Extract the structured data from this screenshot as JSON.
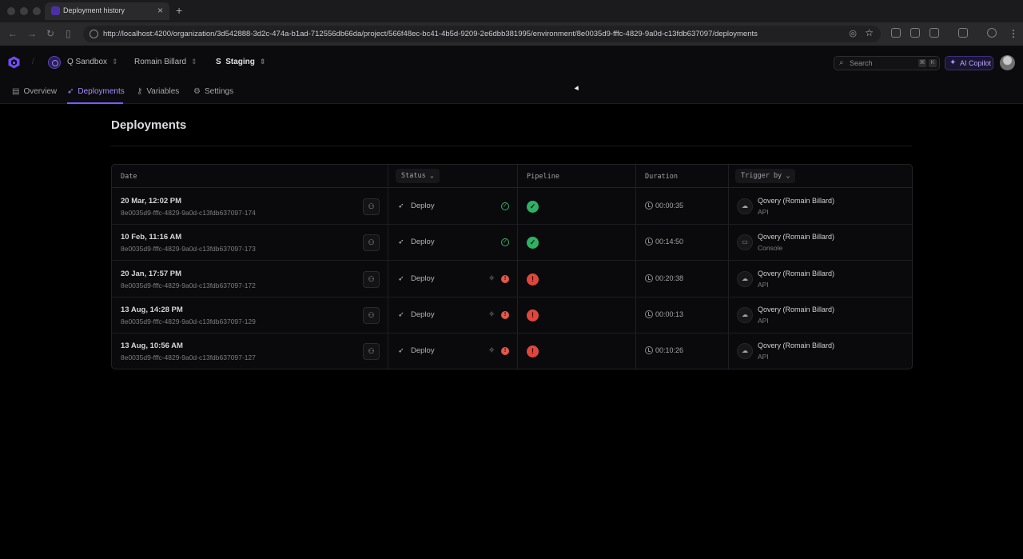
{
  "browser": {
    "tab_title": "Deployment history",
    "tab_close": "×",
    "new_tab": "+",
    "url": "http://localhost:4200/organization/3d542888-3d2c-474a-b1ad-712556db66da/project/566f48ec-bc41-4b5d-9209-2e6dbb381995/environment/8e0035d9-fffc-4829-9a0d-c13fdb637097/deployments"
  },
  "header": {
    "org": "Q Sandbox",
    "project": "Romain Billard",
    "env_badge": "S",
    "environment": "Staging",
    "search_placeholder": "Search",
    "search_keys": [
      "⌘",
      "K"
    ],
    "copilot_label": "AI Copilot"
  },
  "subnav": {
    "items": [
      {
        "label": "Overview",
        "icon": "overview-icon"
      },
      {
        "label": "Deployments",
        "icon": "rocket-icon",
        "active": true
      },
      {
        "label": "Variables",
        "icon": "key-icon"
      },
      {
        "label": "Settings",
        "icon": "gear-icon"
      }
    ]
  },
  "page": {
    "title": "Deployments"
  },
  "table": {
    "columns": {
      "date": "Date",
      "status": "Status",
      "pipeline": "Pipeline",
      "duration": "Duration",
      "trigger": "Trigger by"
    },
    "rows": [
      {
        "date": "20 Mar, 12:02 PM",
        "id": "8e0035d9-fffc-4829-9a0d-c13fdb637097-174",
        "status": "Deploy",
        "result": "success",
        "duration": "00:00:35",
        "trigger": "Qovery (Romain Billard)",
        "source": "API"
      },
      {
        "date": "10 Feb, 11:16 AM",
        "id": "8e0035d9-fffc-4829-9a0d-c13fdb637097-173",
        "status": "Deploy",
        "result": "success",
        "duration": "00:14:50",
        "trigger": "Qovery (Romain Billard)",
        "source": "Console"
      },
      {
        "date": "20 Jan, 17:57 PM",
        "id": "8e0035d9-fffc-4829-9a0d-c13fdb637097-172",
        "status": "Deploy",
        "result": "error",
        "duration": "00:20:38",
        "trigger": "Qovery (Romain Billard)",
        "source": "API"
      },
      {
        "date": "13 Aug, 14:28 PM",
        "id": "8e0035d9-fffc-4829-9a0d-c13fdb637097-129",
        "status": "Deploy",
        "result": "error",
        "duration": "00:00:13",
        "trigger": "Qovery (Romain Billard)",
        "source": "API"
      },
      {
        "date": "13 Aug, 10:56 AM",
        "id": "8e0035d9-fffc-4829-9a0d-c13fdb637097-127",
        "status": "Deploy",
        "result": "error",
        "duration": "00:10:26",
        "trigger": "Qovery (Romain Billard)",
        "source": "API"
      }
    ]
  },
  "colors": {
    "accent": "#7b5cff",
    "success": "#2fb065",
    "error": "#e0463a"
  }
}
